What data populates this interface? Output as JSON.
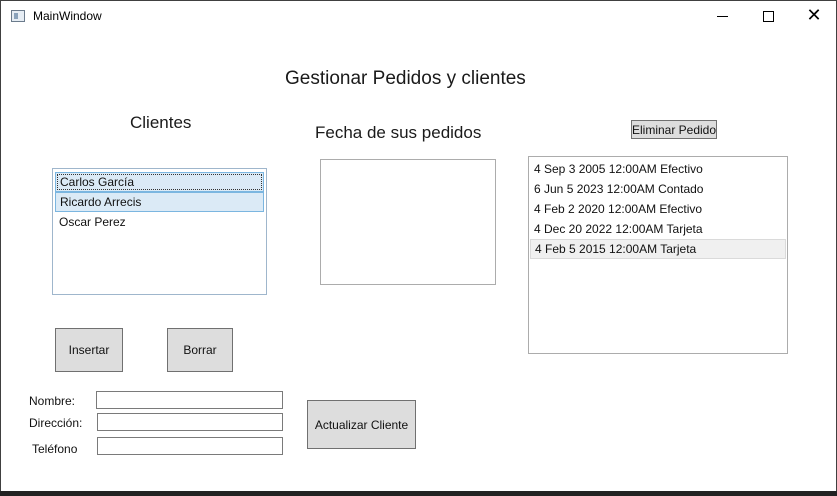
{
  "window": {
    "title": "MainWindow",
    "controls": {
      "minimize": "minimize-icon",
      "maximize": "maximize-icon",
      "close": "close-icon"
    }
  },
  "main_title": "Gestionar Pedidos y clientes",
  "clientes": {
    "heading": "Clientes",
    "items": [
      "Carlos García",
      "Ricardo Arrecis",
      "Oscar Perez"
    ]
  },
  "fechas": {
    "heading": "Fecha de sus pedidos",
    "items": []
  },
  "pedidos": {
    "eliminar_label": "Eliminar Pedido",
    "items": [
      "4 Sep  3 2005 12:00AM Efectivo",
      "6 Jun  5 2023 12:00AM Contado",
      "4 Feb  2 2020 12:00AM Efectivo",
      "4 Dec 20 2022 12:00AM Tarjeta",
      "4 Feb  5 2015 12:00AM Tarjeta"
    ]
  },
  "buttons": {
    "insertar": "Insertar",
    "borrar": "Borrar",
    "actualizar": "Actualizar Cliente"
  },
  "form": {
    "nombre_label": "Nombre:",
    "nombre_value": "",
    "direccion_label": "Dirección:",
    "direccion_value": "",
    "telefono_label": "Teléfono",
    "telefono_value": ""
  },
  "colors": {
    "selection": "#dbeaf6",
    "selection_border": "#7bb6e0",
    "button_face": "#dddddd"
  }
}
